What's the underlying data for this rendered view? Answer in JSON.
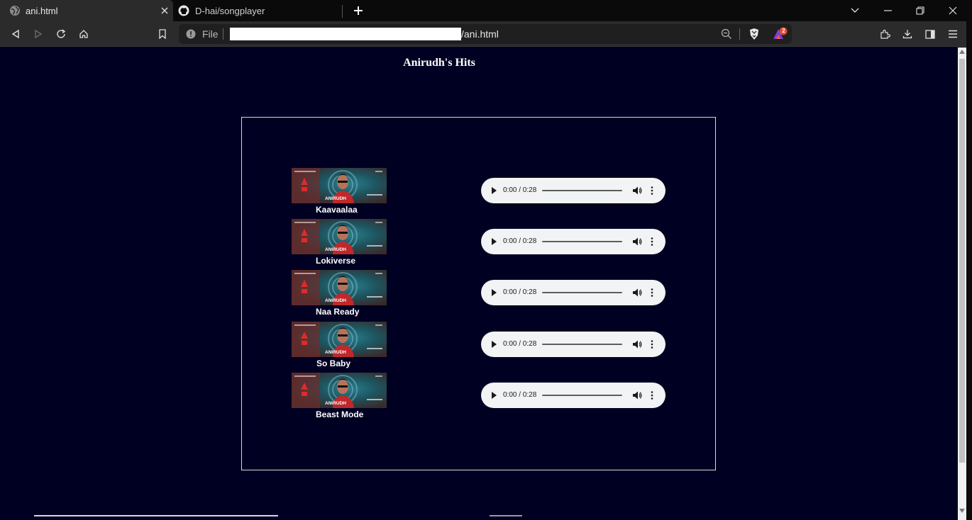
{
  "browser": {
    "tabs": [
      {
        "title": "ani.html",
        "active": true,
        "icon": "globe-icon"
      },
      {
        "title": "D-hai/songplayer",
        "active": false,
        "icon": "github-icon"
      }
    ],
    "address": {
      "scheme_label": "File",
      "path_suffix": "/ani.html"
    },
    "rewards_badge": "2",
    "colors": {
      "tabstrip": "#0a0a0a",
      "toolbar": "#2b2b2b",
      "page_bg": "#000022",
      "audio_bg": "#f1f3f4"
    }
  },
  "page": {
    "title": "Anirudh's Hits",
    "songs": [
      {
        "name": "Kaavaalaa",
        "time": "0:00 / 0:28"
      },
      {
        "name": "Lokiverse",
        "time": "0:00 / 0:28"
      },
      {
        "name": "Naa Ready",
        "time": "0:00 / 0:28"
      },
      {
        "name": "So Baby",
        "time": "0:00 / 0:28"
      },
      {
        "name": "Beast Mode",
        "time": "0:00 / 0:28"
      }
    ],
    "cover_art_text": "ANIRUDH"
  }
}
